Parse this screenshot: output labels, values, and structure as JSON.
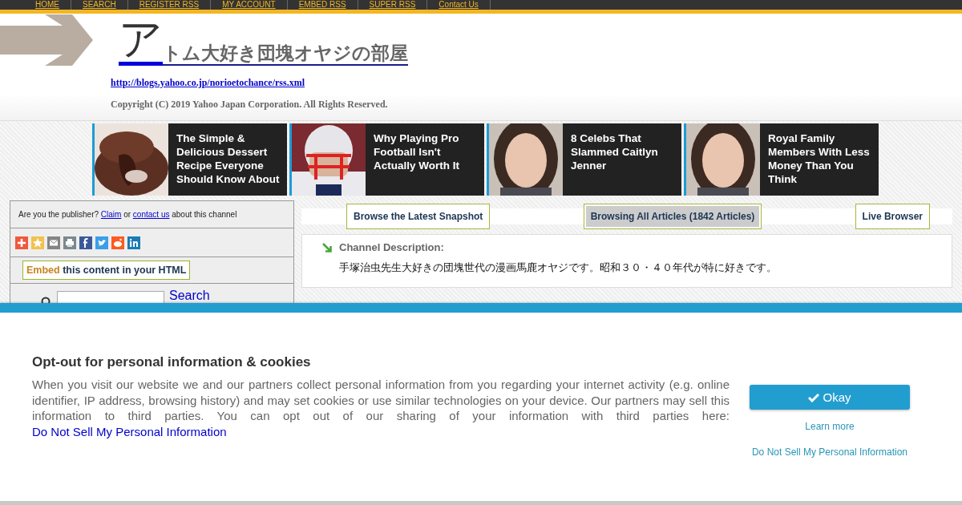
{
  "nav": [
    {
      "label": "HOME"
    },
    {
      "label": "SEARCH"
    },
    {
      "label": "REGISTER RSS"
    },
    {
      "label": "MY ACCOUNT"
    },
    {
      "label": "EMBED RSS"
    },
    {
      "label": "SUPER RSS"
    },
    {
      "label": "Contact Us"
    }
  ],
  "header": {
    "title_initial": "ア",
    "title_rest": "トム大好き団塊オヤジの部屋",
    "feed_url": "http://blogs.yahoo.co.jp/norioetochance/rss.xml",
    "copyright": "Copyright (C) 2019 Yahoo Japan Corporation. All Rights Reserved."
  },
  "ads": [
    {
      "title": "The Simple & Delicious Dessert Recipe Everyone Should Know About",
      "kind": "dessert"
    },
    {
      "title": "Why Playing Pro Football Isn't Actually Worth It",
      "kind": "helmet"
    },
    {
      "title": "8 Celebs That Slammed Caitlyn Jenner",
      "kind": "person"
    },
    {
      "title": "Royal Family Members With Less Money Than You Think",
      "kind": "person"
    }
  ],
  "publisher": {
    "lead": "Are you the publisher?",
    "claim": "Claim",
    "or": "or",
    "contact": "contact us",
    "tail": "about this channel"
  },
  "share_icons": [
    {
      "kind": "plus"
    },
    {
      "kind": "star"
    },
    {
      "kind": "email"
    },
    {
      "kind": "print"
    },
    {
      "kind": "facebook"
    },
    {
      "kind": "twitter"
    },
    {
      "kind": "reddit"
    },
    {
      "kind": "linkedin"
    }
  ],
  "embed": {
    "highlight": "Embed",
    "rest": "this content in your HTML"
  },
  "search": {
    "button": "Search"
  },
  "tabs": [
    {
      "label": "Browse the Latest Snapshot",
      "selected": false
    },
    {
      "label": "Browsing All Articles (1842 Articles)",
      "selected": true
    },
    {
      "label": "Live Browser",
      "selected": false
    }
  ],
  "description": {
    "heading": "Channel Description:",
    "text": "手塚治虫先生大好きの団塊世代の漫画馬鹿オヤジです。昭和３０・４０年代が特に好きです。"
  },
  "cookie": {
    "title": "Opt-out for personal information & cookies",
    "body": "When you visit our website we and our partners collect personal information from you regarding your internet activity (e.g. online identifier, IP address, browsing history) and may set cookies or use similar technologies on your device. Our partners may sell this information to third parties. You can opt out of our sharing of your information with third parties here:",
    "link": "Do Not Sell My Personal Information",
    "ok": "Okay",
    "learn_more": "Learn more",
    "do_not_sell": "Do Not Sell My Personal Information"
  }
}
